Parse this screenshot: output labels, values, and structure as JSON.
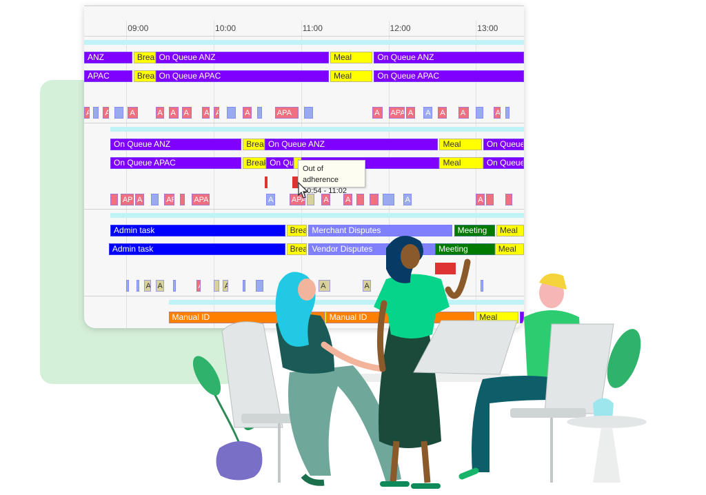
{
  "timeline": {
    "view_start": "08:31",
    "view_end": "13:33",
    "ticks": [
      "09:00",
      "10:00",
      "11:00",
      "12:00",
      "13:00"
    ],
    "colors": {
      "queue": "#8000ff",
      "break": "#ffff00",
      "admin": "#0000ff",
      "dispute": "#8080ff",
      "meeting": "#007a00",
      "manual": "#ff8000",
      "adherence": "#dd3333",
      "mini_red": "#f07080",
      "mini_blue": "#99aaee",
      "mini_khaki": "#d8d29a",
      "cyan": "#bff3f5"
    },
    "groups": [
      {
        "cyan": [
          "08:31",
          "13:33"
        ],
        "rows": [
          [
            [
              "08:31",
              "09:04",
              "queue",
              "ANZ"
            ],
            [
              "09:05",
              "09:20",
              "break",
              "Break"
            ],
            [
              "09:20",
              "11:19",
              "queue",
              "On Queue ANZ"
            ],
            [
              "11:20",
              "11:49",
              "break",
              "Meal"
            ],
            [
              "11:50",
              "13:33",
              "queue",
              "On Queue ANZ"
            ]
          ],
          [
            [
              "08:31",
              "09:04",
              "queue",
              "APAC"
            ],
            [
              "09:05",
              "09:20",
              "break",
              "Break"
            ],
            [
              "09:20",
              "11:19",
              "queue",
              "On Queue APAC"
            ],
            [
              "11:20",
              "11:49",
              "break",
              "Meal"
            ],
            [
              "11:50",
              "13:33",
              "queue",
              "On Queue APAC"
            ]
          ]
        ],
        "mini": [
          [
            "08:31",
            "08:35",
            "mini_red",
            "A"
          ],
          [
            "08:37",
            "08:41",
            "mini_blue",
            ""
          ],
          [
            "08:44",
            "08:48",
            "mini_red",
            "A"
          ],
          [
            "08:52",
            "08:58",
            "mini_blue",
            ""
          ],
          [
            "09:01",
            "09:08",
            "mini_red",
            "A"
          ],
          [
            "09:20",
            "09:26",
            "mini_red",
            "A"
          ],
          [
            "09:29",
            "09:36",
            "mini_red",
            "A"
          ],
          [
            "09:38",
            "09:45",
            "mini_red",
            "A"
          ],
          [
            "09:52",
            "09:57",
            "mini_red",
            "A"
          ],
          [
            "10:00",
            "10:04",
            "mini_red",
            "A"
          ],
          [
            "10:09",
            "10:15",
            "mini_blue",
            ""
          ],
          [
            "10:20",
            "10:26",
            "mini_red",
            "A"
          ],
          [
            "10:30",
            "10:33",
            "mini_blue",
            ""
          ],
          [
            "10:42",
            "10:58",
            "mini_red",
            "APA"
          ],
          [
            "11:02",
            "11:08",
            "mini_blue",
            ""
          ],
          [
            "11:49",
            "11:56",
            "mini_red",
            "A"
          ],
          [
            "12:00",
            "12:11",
            "mini_red",
            "APA"
          ],
          [
            "12:12",
            "12:18",
            "mini_red",
            "A"
          ],
          [
            "12:24",
            "12:30",
            "mini_blue",
            "A"
          ],
          [
            "12:34",
            "12:40",
            "mini_red",
            "A"
          ],
          [
            "12:48",
            "12:55",
            "mini_red",
            "A"
          ],
          [
            "13:00",
            "13:05",
            "mini_blue",
            ""
          ],
          [
            "13:12",
            "13:17",
            "mini_red",
            "A"
          ],
          [
            "13:20",
            "13:23",
            "mini_blue",
            ""
          ]
        ]
      },
      {
        "cyan": [
          "08:49",
          "13:33"
        ],
        "rows": [
          [
            [
              "08:49",
              "10:19",
              "queue",
              "On Queue ANZ"
            ],
            [
              "10:20",
              "10:35",
              "break",
              "Break"
            ],
            [
              "10:35",
              "12:34",
              "queue",
              "On Queue ANZ"
            ],
            [
              "12:35",
              "13:04",
              "break",
              "Meal"
            ],
            [
              "13:05",
              "13:33",
              "queue",
              "On Queue"
            ]
          ],
          [
            [
              "08:49",
              "10:19",
              "queue",
              "On Queue APAC"
            ],
            [
              "10:20",
              "10:36",
              "break",
              "Break"
            ],
            [
              "10:36",
              "10:55",
              "queue",
              "On Qu"
            ],
            [
              "10:55",
              "11:00",
              "break",
              "U"
            ],
            [
              "11:00",
              "12:35",
              "queue",
              ""
            ],
            [
              "12:35",
              "13:05",
              "break",
              "Meal"
            ],
            [
              "13:05",
              "13:33",
              "queue",
              "On Queue"
            ]
          ]
        ],
        "adherence": [
          [
            "10:35",
            "10:36"
          ],
          [
            "10:54",
            "11:02"
          ]
        ],
        "tooltip": {
          "title": "Out of adherence",
          "range": "10:54 - 11:02"
        },
        "mini": [
          [
            "08:49",
            "08:54",
            "mini_red",
            ""
          ],
          [
            "08:56",
            "09:05",
            "mini_red",
            "AP"
          ],
          [
            "09:06",
            "09:12",
            "mini_red",
            "A"
          ],
          [
            "09:17",
            "09:22",
            "mini_blue",
            ""
          ],
          [
            "09:26",
            "09:33",
            "mini_red",
            "AP"
          ],
          [
            "09:37",
            "09:40",
            "mini_red",
            ""
          ],
          [
            "09:45",
            "09:57",
            "mini_red",
            "APA"
          ],
          [
            "10:36",
            "10:42",
            "mini_blue",
            "A"
          ],
          [
            "10:52",
            "11:03",
            "mini_red",
            "APA"
          ],
          [
            "11:04",
            "11:09",
            "mini_khaki",
            ""
          ],
          [
            "11:14",
            "11:20",
            "mini_red",
            "A"
          ],
          [
            "11:29",
            "11:35",
            "mini_red",
            "A"
          ],
          [
            "11:38",
            "11:43",
            "mini_red",
            ""
          ],
          [
            "11:47",
            "11:53",
            "mini_red",
            ""
          ],
          [
            "11:56",
            "12:04",
            "mini_blue",
            ""
          ],
          [
            "12:10",
            "12:16",
            "mini_blue",
            "A"
          ],
          [
            "13:00",
            "13:06",
            "mini_red",
            "A"
          ],
          [
            "13:07",
            "13:12",
            "mini_red",
            ""
          ],
          [
            "13:20",
            "13:25",
            "mini_red",
            ""
          ]
        ]
      },
      {
        "cyan": [
          "08:49",
          "13:33"
        ],
        "rows": [
          [
            [
              "08:49",
              "10:49",
              "admin",
              "Admin task"
            ],
            [
              "10:50",
              "11:04",
              "break",
              "Break"
            ],
            [
              "11:05",
              "12:44",
              "dispute",
              "Merchant Disputes"
            ],
            [
              "12:45",
              "13:13",
              "meeting",
              "Meeting"
            ],
            [
              "13:14",
              "13:33",
              "break",
              "Meal"
            ]
          ],
          [
            [
              "08:48",
              "10:49",
              "admin",
              "Admin task"
            ],
            [
              "10:50",
              "11:04",
              "break",
              "Break"
            ],
            [
              "11:05",
              "12:29",
              "dispute",
              "Vendor Disputes"
            ],
            [
              "12:29",
              "12:32",
              "dispute",
              "Vendor"
            ],
            [
              "12:32",
              "13:13",
              "meeting",
              "Meeting"
            ],
            [
              "13:13",
              "13:33",
              "break",
              "Meal"
            ]
          ]
        ],
        "adherence": [
          [
            "12:32",
            "12:46"
          ]
        ],
        "mini": [
          [
            "09:00",
            "09:02",
            "mini_blue",
            ""
          ],
          [
            "09:07",
            "09:09",
            "mini_blue",
            ""
          ],
          [
            "09:12",
            "09:17",
            "mini_khaki",
            "A"
          ],
          [
            "09:20",
            "09:26",
            "mini_khaki",
            "A"
          ],
          [
            "09:32",
            "09:34",
            "mini_blue",
            ""
          ],
          [
            "09:48",
            "09:51",
            "mini_red",
            "A"
          ],
          [
            "10:00",
            "10:04",
            "mini_khaki",
            ""
          ],
          [
            "10:06",
            "10:10",
            "mini_khaki",
            "A"
          ],
          [
            "10:20",
            "10:22",
            "mini_blue",
            ""
          ],
          [
            "10:29",
            "10:34",
            "mini_blue",
            ""
          ],
          [
            "11:12",
            "11:20",
            "mini_khaki",
            "A"
          ],
          [
            "11:42",
            "11:48",
            "mini_khaki",
            "A"
          ],
          [
            "13:03",
            "13:05",
            "mini_blue",
            ""
          ]
        ]
      },
      {
        "cyan": [
          "09:29",
          "13:33"
        ],
        "rows": [
          [
            [
              "09:29",
              "11:16",
              "manual",
              "Manual ID"
            ],
            [
              "11:16",
              "11:17",
              "break",
              ""
            ],
            [
              "11:17",
              "12:59",
              "manual",
              "Manual ID"
            ],
            [
              "13:00",
              "13:29",
              "break",
              "Meal"
            ],
            [
              "13:30",
              "13:33",
              "queue",
              ""
            ]
          ]
        ]
      }
    ]
  }
}
